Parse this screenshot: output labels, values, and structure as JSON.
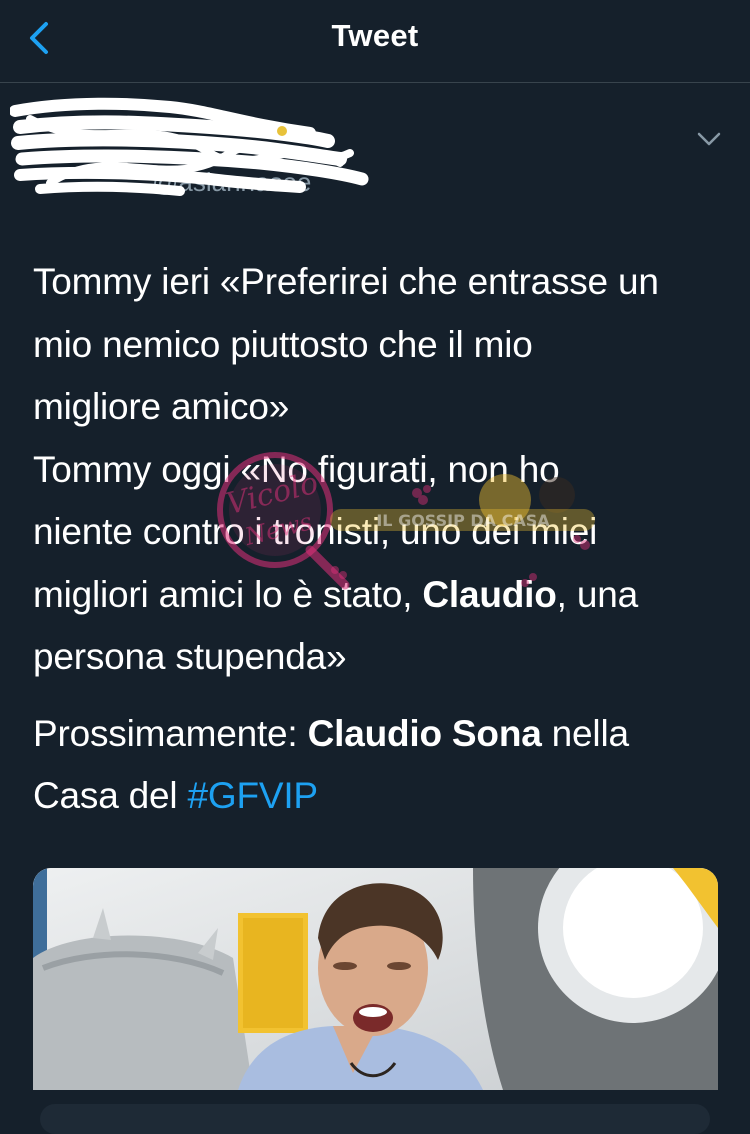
{
  "header": {
    "title": "Tweet",
    "back_icon": "chevron-left-icon"
  },
  "author": {
    "handle_fragment": "@aslannasee",
    "menu_icon": "chevron-down-icon"
  },
  "tweet": {
    "line1": "Tommy ieri «Preferirei che entrasse un",
    "line2": "mio nemico piuttosto che il mio",
    "line3": "migliore amico»",
    "line4": "Tommy oggi «No figurati, non ho",
    "line5": "niente contro i tronisti, uno dei miei",
    "line6_pre": "migliori amici lo è stato, ",
    "line6_bold": "Claudio",
    "line6_post": ", una",
    "line7": "persona stupenda»",
    "p2_line1_pre": "Prossimamente: ",
    "p2_line1_bold": "Claudio Sona",
    "p2_line1_post": " nella",
    "p2_line2_pre": "Casa del ",
    "hashtag": "#GFVIP"
  },
  "watermark": {
    "brand_text": "Vicolo News",
    "overlay_text": "IL GOSSIP DA CASA"
  },
  "colors": {
    "background": "#15202b",
    "text": "#ffffff",
    "accent": "#1da1f2",
    "divider": "#38444d",
    "muted": "#8899a6"
  }
}
